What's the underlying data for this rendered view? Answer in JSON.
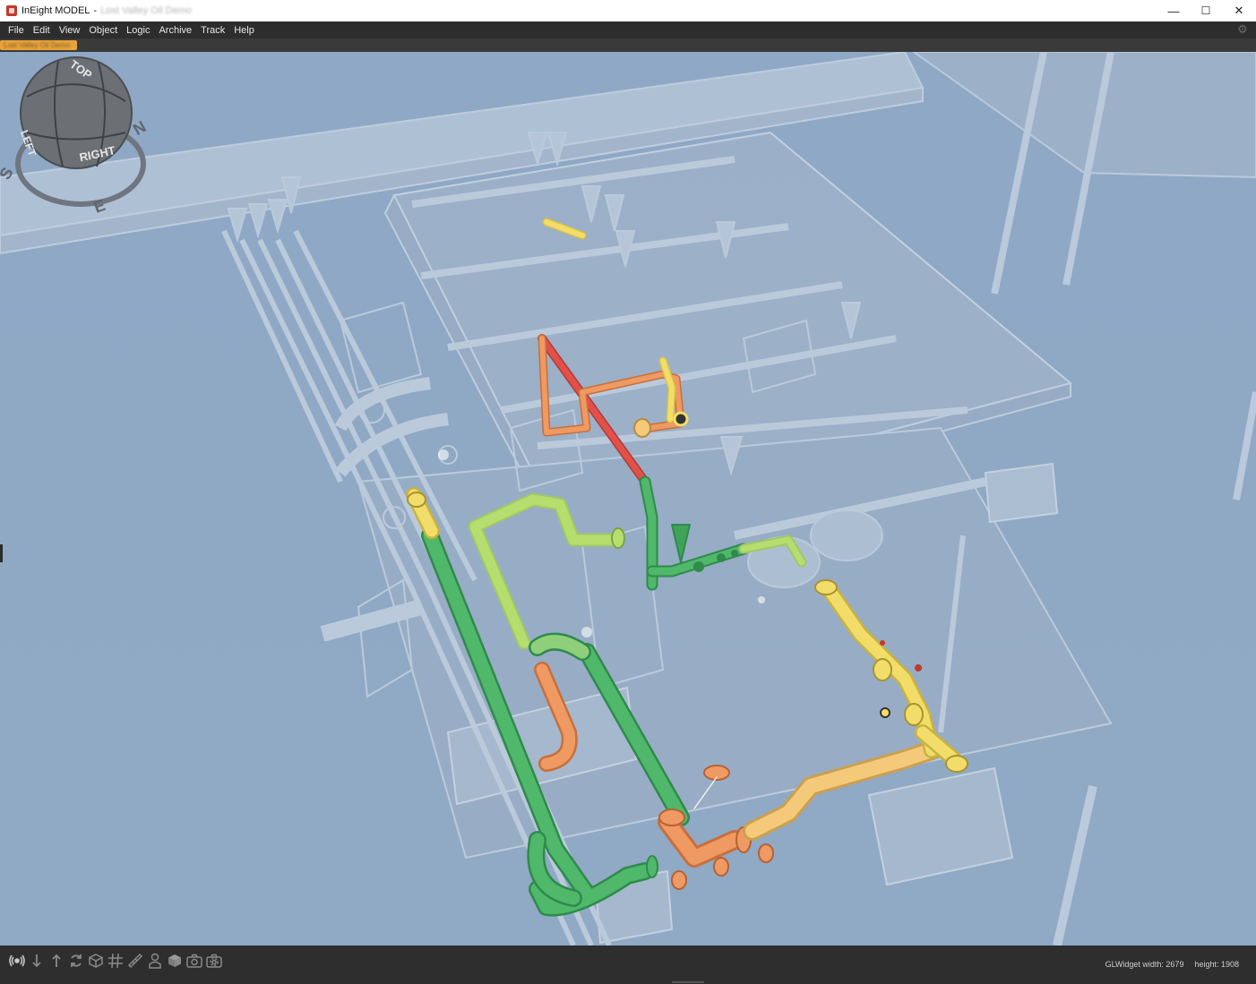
{
  "window": {
    "app_title": "InEight MODEL",
    "separator": "-",
    "document_title": "Lost Valley Oil Demo",
    "controls": {
      "minimize": "—",
      "maximize": "☐",
      "close": "✕"
    }
  },
  "menu": [
    "File",
    "Edit",
    "View",
    "Object",
    "Logic",
    "Archive",
    "Track",
    "Help"
  ],
  "document_tab": {
    "label": "Lost Valley Oil Demo"
  },
  "view_cube": {
    "faces": {
      "top": "TOP",
      "right": "RIGHT",
      "left": "LEFT"
    },
    "compass": {
      "north": "N",
      "south": "S",
      "east": "E"
    }
  },
  "status": {
    "gl_widget_width": "GLWidget  width: 2679",
    "gl_widget_height": "height: 1908"
  },
  "toolbar_icons": [
    "broadcast-icon",
    "arrow-down-icon",
    "arrow-up-icon",
    "refresh-icon",
    "wireframe-cube-icon",
    "grid-icon",
    "ruler-icon",
    "person-icon",
    "solid-cube-icon",
    "camera-icon",
    "camera-settings-icon"
  ],
  "colors": {
    "viewport_bg": "#90aac6",
    "pipe_red": "#e2504a",
    "pipe_orange": "#ef9a62",
    "pipe_yellow": "#f3dd6a",
    "pipe_lightgreen": "#b6de6e",
    "pipe_green": "#4fb86a",
    "pipe_tan": "#f5c97a",
    "accent_tab": "#e8a33a"
  }
}
